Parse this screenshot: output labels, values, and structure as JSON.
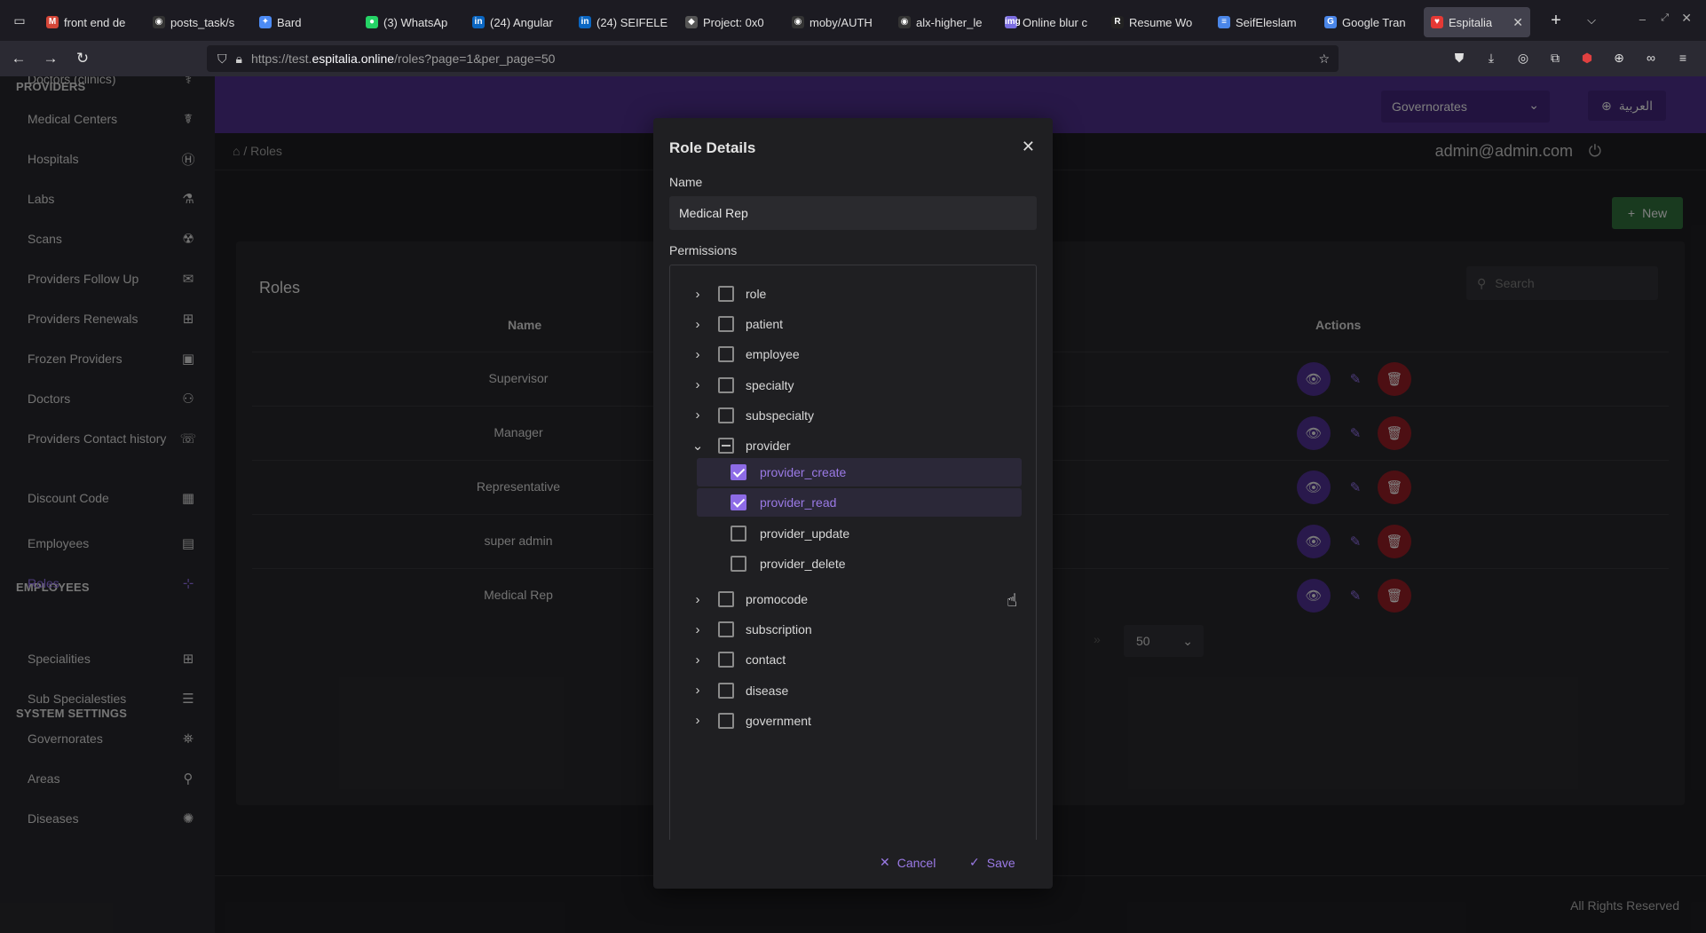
{
  "browser": {
    "tabs": [
      {
        "label": "front end de",
        "fav": "M",
        "color": "#d44638"
      },
      {
        "label": "posts_task/s",
        "fav": "◉",
        "color": "#333"
      },
      {
        "label": "Bard",
        "fav": "✦",
        "color": "#4c8bf5"
      },
      {
        "label": "(3) WhatsAp",
        "fav": "●",
        "color": "#25d366"
      },
      {
        "label": "(24) Angular",
        "fav": "in",
        "color": "#0a66c2"
      },
      {
        "label": "(24) SEIFELE",
        "fav": "in",
        "color": "#0a66c2"
      },
      {
        "label": "Project: 0x0",
        "fav": "◆",
        "color": "#555"
      },
      {
        "label": "moby/AUTH",
        "fav": "◉",
        "color": "#333"
      },
      {
        "label": "alx-higher_le",
        "fav": "◉",
        "color": "#333"
      },
      {
        "label": "Online blur c",
        "fav": "img",
        "color": "#7b6de0"
      },
      {
        "label": "Resume Wo",
        "fav": "R",
        "color": "#222"
      },
      {
        "label": "SeifEleslam",
        "fav": "≡",
        "color": "#4a86e8"
      },
      {
        "label": "Google Tran",
        "fav": "G",
        "color": "#4a86e8"
      },
      {
        "label": "Espitalia",
        "fav": "♥",
        "color": "#e53935",
        "active": true
      }
    ],
    "url_prefix": "https://test.",
    "url_host": "espitalia.online",
    "url_path": "/roles?page=1&per_page=50"
  },
  "sidebar": {
    "sections": [
      {
        "title": "PROVIDERS"
      },
      {
        "title": "EMPLOYEES"
      },
      {
        "title": "SYSTEM SETTINGS"
      }
    ],
    "items": [
      {
        "label": "Doctors (clinics)",
        "icon": "stethoscope-icon",
        "glyph": "⚕"
      },
      {
        "label": "Medical Centers",
        "icon": "medical-sign-icon",
        "glyph": "☤"
      },
      {
        "label": "Hospitals",
        "icon": "hospital-icon",
        "glyph": "Ⓗ"
      },
      {
        "label": "Labs",
        "icon": "flask-icon",
        "glyph": "⚗"
      },
      {
        "label": "Scans",
        "icon": "radiation-icon",
        "glyph": "☢"
      },
      {
        "label": "Providers Follow Up",
        "icon": "inbox-icon",
        "glyph": "✉"
      },
      {
        "label": "Providers Renewals",
        "icon": "plus-square-icon",
        "glyph": "⊞"
      },
      {
        "label": "Frozen Providers",
        "icon": "portrait-icon",
        "glyph": "▣"
      },
      {
        "label": "Doctors",
        "icon": "doctor-icon",
        "glyph": "⚇"
      },
      {
        "label": "Providers Contact history",
        "icon": "phone-icon",
        "glyph": "☏"
      },
      {
        "label": "Discount Code",
        "icon": "qrcode-icon",
        "glyph": "▦"
      },
      {
        "label": "Employees",
        "icon": "briefcase-icon",
        "glyph": "▤"
      },
      {
        "label": "Roles",
        "icon": "sitemap-icon",
        "glyph": "⊹"
      },
      {
        "label": "Specialities",
        "icon": "grid-icon",
        "glyph": "⊞"
      },
      {
        "label": "Sub Specialesties",
        "icon": "tree-icon",
        "glyph": "☰"
      },
      {
        "label": "Governorates",
        "icon": "map-icon",
        "glyph": "⛯"
      },
      {
        "label": "Areas",
        "icon": "pin-icon",
        "glyph": "⚲"
      },
      {
        "label": "Diseases",
        "icon": "virus-icon",
        "glyph": "✺"
      }
    ]
  },
  "topbar": {
    "governorates": "Governorates",
    "language": "العربية"
  },
  "header": {
    "breadcrumb": "/ Roles",
    "user": "admin@admin.com"
  },
  "roles_page": {
    "new_label": "New",
    "title": "Roles",
    "search_placeholder": "Search",
    "columns": {
      "name": "Name",
      "actions": "Actions"
    },
    "rows": [
      "Supervisor",
      "Manager",
      "Representative",
      "super admin",
      "Medical Rep"
    ],
    "per_page": "50",
    "footer": "All Rights Reserved"
  },
  "modal": {
    "title": "Role Details",
    "name_label": "Name",
    "name_value": "Medical Rep",
    "permissions_label": "Permissions",
    "groups": [
      {
        "label": "role",
        "state": "collapsed"
      },
      {
        "label": "patient",
        "state": "collapsed"
      },
      {
        "label": "employee",
        "state": "collapsed"
      },
      {
        "label": "specialty",
        "state": "collapsed"
      },
      {
        "label": "subspecialty",
        "state": "collapsed"
      },
      {
        "label": "provider",
        "state": "expanded",
        "children": [
          {
            "label": "provider_create",
            "checked": true
          },
          {
            "label": "provider_read",
            "checked": true
          },
          {
            "label": "provider_update",
            "checked": false
          },
          {
            "label": "provider_delete",
            "checked": false
          }
        ]
      },
      {
        "label": "promocode",
        "state": "collapsed"
      },
      {
        "label": "subscription",
        "state": "collapsed"
      },
      {
        "label": "contact",
        "state": "collapsed"
      },
      {
        "label": "disease",
        "state": "collapsed"
      },
      {
        "label": "government",
        "state": "collapsed"
      }
    ],
    "cancel_label": "Cancel",
    "save_label": "Save"
  }
}
